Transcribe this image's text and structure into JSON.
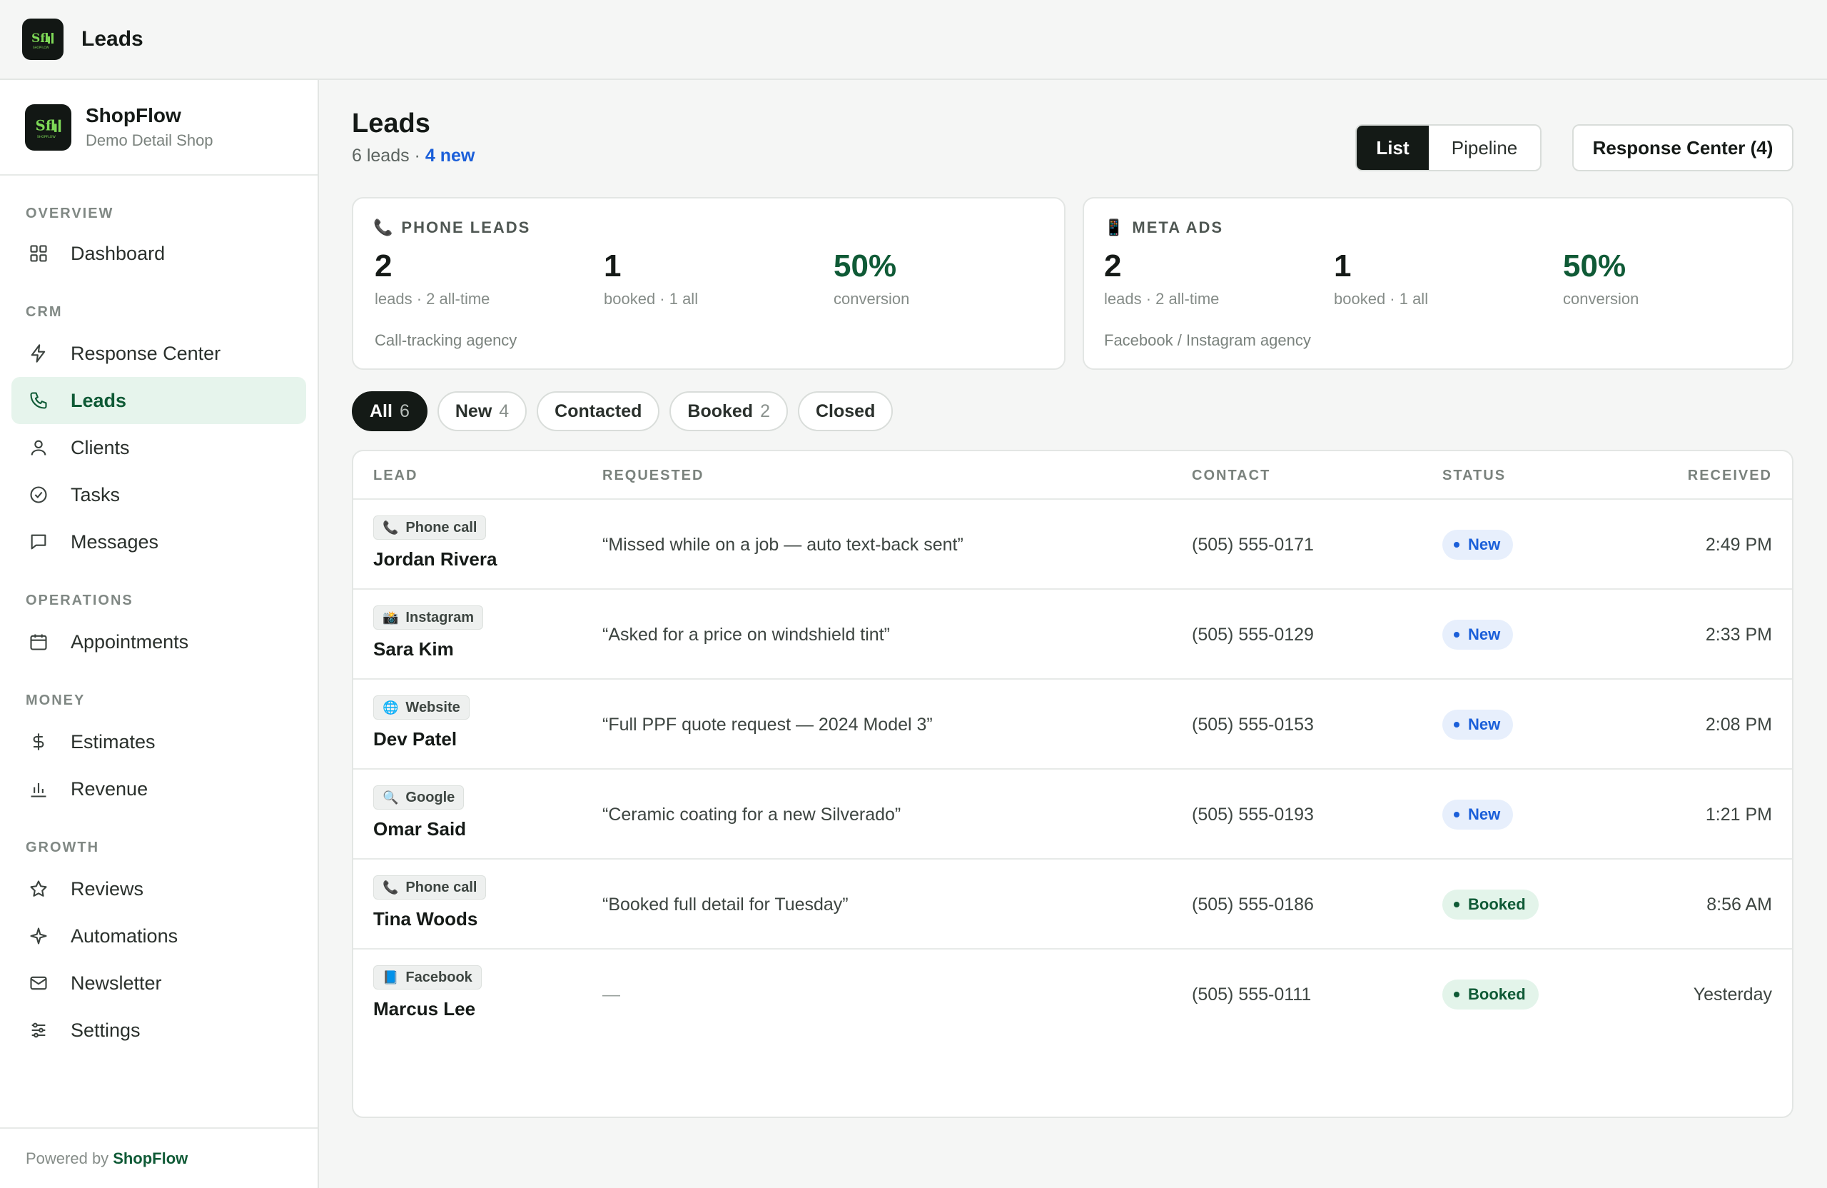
{
  "app": {
    "title": "Leads"
  },
  "brand": {
    "name": "ShopFlow",
    "subtitle": "Demo Detail Shop",
    "logo_text": "SHOPFLOW"
  },
  "sidebar": {
    "sections": [
      {
        "label": "OVERVIEW",
        "items": [
          {
            "label": "Dashboard",
            "icon": "grid-icon"
          }
        ]
      },
      {
        "label": "CRM",
        "items": [
          {
            "label": "Response Center",
            "icon": "bolt-icon"
          },
          {
            "label": "Leads",
            "icon": "phone-icon",
            "active": true
          },
          {
            "label": "Clients",
            "icon": "user-icon"
          },
          {
            "label": "Tasks",
            "icon": "check-circle-icon"
          },
          {
            "label": "Messages",
            "icon": "chat-icon"
          }
        ]
      },
      {
        "label": "OPERATIONS",
        "items": [
          {
            "label": "Appointments",
            "icon": "calendar-icon"
          }
        ]
      },
      {
        "label": "MONEY",
        "items": [
          {
            "label": "Estimates",
            "icon": "dollar-icon"
          },
          {
            "label": "Revenue",
            "icon": "bar-chart-icon"
          }
        ]
      },
      {
        "label": "GROWTH",
        "items": [
          {
            "label": "Reviews",
            "icon": "star-icon"
          },
          {
            "label": "Automations",
            "icon": "sparkle-icon"
          },
          {
            "label": "Newsletter",
            "icon": "mail-icon"
          },
          {
            "label": "Settings",
            "icon": "sliders-icon"
          }
        ]
      }
    ],
    "powered_prefix": "Powered by",
    "powered_brand": "ShopFlow"
  },
  "header": {
    "title": "Leads",
    "count_text": "6 leads · ",
    "new_text": "4 new",
    "view_list": "List",
    "view_pipeline": "Pipeline",
    "response_center_button": "Response Center (4)"
  },
  "cards": [
    {
      "icon": "📞",
      "title": "PHONE LEADS",
      "leads": "2",
      "leads_caption": "leads · 2 all-time",
      "booked": "1",
      "booked_caption": "booked · 1 all",
      "conversion": "50%",
      "conversion_caption": "conversion",
      "footer": "Call-tracking agency"
    },
    {
      "icon": "📱",
      "title": "META ADS",
      "leads": "2",
      "leads_caption": "leads · 2 all-time",
      "booked": "1",
      "booked_caption": "booked · 1 all",
      "conversion": "50%",
      "conversion_caption": "conversion",
      "footer": "Facebook / Instagram agency"
    }
  ],
  "filters": [
    {
      "label": "All",
      "count": "6",
      "active": true
    },
    {
      "label": "New",
      "count": "4"
    },
    {
      "label": "Contacted",
      "count": ""
    },
    {
      "label": "Booked",
      "count": "2"
    },
    {
      "label": "Closed",
      "count": ""
    }
  ],
  "table": {
    "columns": {
      "lead": "LEAD",
      "requested": "REQUESTED",
      "contact": "CONTACT",
      "status": "STATUS",
      "received": "RECEIVED"
    },
    "rows": [
      {
        "source_icon": "📞",
        "source": "Phone call",
        "name": "Jordan Rivera",
        "requested": "“Missed while on a job — auto text-back sent”",
        "contact": "(505) 555-0171",
        "status": "New",
        "received": "2:49 PM"
      },
      {
        "source_icon": "📸",
        "source": "Instagram",
        "name": "Sara Kim",
        "requested": "“Asked for a price on windshield tint”",
        "contact": "(505) 555-0129",
        "status": "New",
        "received": "2:33 PM"
      },
      {
        "source_icon": "🌐",
        "source": "Website",
        "name": "Dev Patel",
        "requested": "“Full PPF quote request — 2024 Model 3”",
        "contact": "(505) 555-0153",
        "status": "New",
        "received": "2:08 PM"
      },
      {
        "source_icon": "🔍",
        "source": "Google",
        "name": "Omar Said",
        "requested": "“Ceramic coating for a new Silverado”",
        "contact": "(505) 555-0193",
        "status": "New",
        "received": "1:21 PM"
      },
      {
        "source_icon": "📞",
        "source": "Phone call",
        "name": "Tina Woods",
        "requested": "“Booked full detail for Tuesday”",
        "contact": "(505) 555-0186",
        "status": "Booked",
        "received": "8:56 AM"
      },
      {
        "source_icon": "📘",
        "source": "Facebook",
        "name": "Marcus Lee",
        "requested": "—",
        "contact": "(505) 555-0111",
        "status": "Booked",
        "received": "Yesterday"
      }
    ]
  },
  "colors": {
    "accent": "#0f5a36",
    "dark": "#141a16",
    "new_blue": "#1b5fd9",
    "active_bg": "#e6f4ec"
  }
}
